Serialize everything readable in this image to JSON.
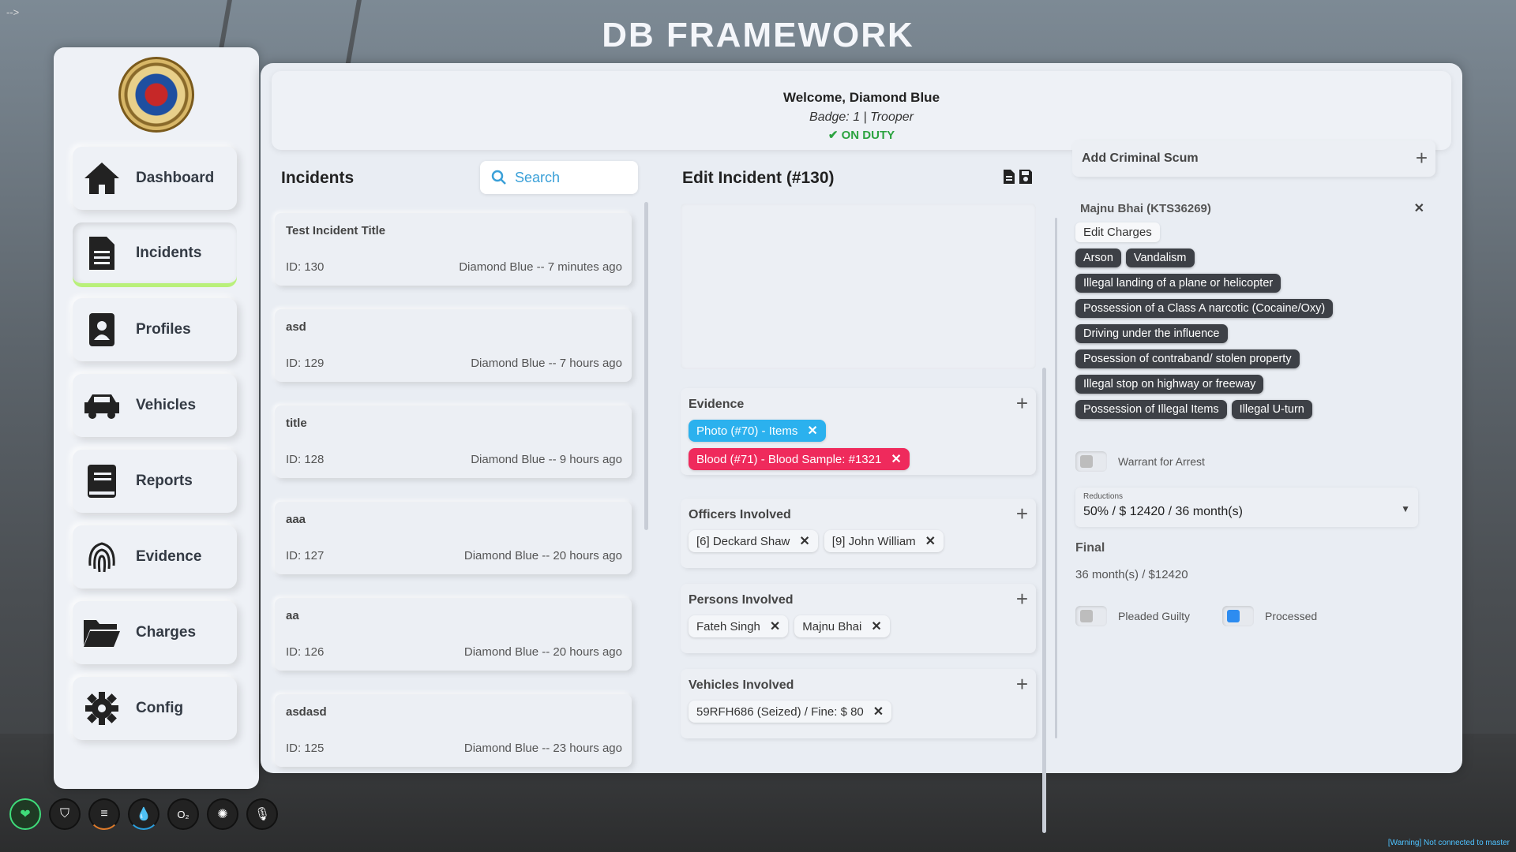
{
  "page": {
    "corner_mark": "-->",
    "app_title": "DB FRAMEWORK"
  },
  "sidebar": {
    "items": [
      {
        "label": "Dashboard",
        "icon": "home-icon"
      },
      {
        "label": "Incidents",
        "icon": "document-icon",
        "active": true
      },
      {
        "label": "Profiles",
        "icon": "id-badge-icon"
      },
      {
        "label": "Vehicles",
        "icon": "car-icon"
      },
      {
        "label": "Reports",
        "icon": "book-icon"
      },
      {
        "label": "Evidence",
        "icon": "fingerprint-icon"
      },
      {
        "label": "Charges",
        "icon": "folder-icon"
      },
      {
        "label": "Config",
        "icon": "gear-icon"
      }
    ]
  },
  "header": {
    "welcome": "Welcome, Diamond Blue",
    "badge": "Badge: 1 | Trooper",
    "status": "ON DUTY",
    "status_color": "#2ca340"
  },
  "incidents": {
    "title": "Incidents",
    "search_placeholder": "Search",
    "list": [
      {
        "title": "Test Incident Title",
        "id": "ID: 130",
        "meta": "Diamond Blue -- 7 minutes ago"
      },
      {
        "title": "asd",
        "id": "ID: 129",
        "meta": "Diamond Blue -- 7 hours ago"
      },
      {
        "title": "title",
        "id": "ID: 128",
        "meta": "Diamond Blue -- 9 hours ago"
      },
      {
        "title": "aaa",
        "id": "ID: 127",
        "meta": "Diamond Blue -- 20 hours ago"
      },
      {
        "title": "aa",
        "id": "ID: 126",
        "meta": "Diamond Blue -- 20 hours ago"
      },
      {
        "title": "asdasd",
        "id": "ID: 125",
        "meta": "Diamond Blue -- 23 hours ago"
      }
    ]
  },
  "edit": {
    "title": "Edit Incident (#130)",
    "evidence": {
      "title": "Evidence",
      "tags": [
        {
          "label": "Photo (#70) - Items",
          "color": "#2bb1ee"
        },
        {
          "label": "Blood (#71) - Blood Sample: #1321",
          "color": "#ef2a5c"
        }
      ]
    },
    "officers": {
      "title": "Officers Involved",
      "tags": [
        "[6] Deckard Shaw",
        "[9] John William"
      ]
    },
    "persons": {
      "title": "Persons Involved",
      "tags": [
        "Fateh Singh",
        "Majnu Bhai"
      ]
    },
    "vehicles": {
      "title": "Vehicles Involved",
      "tags": [
        "59RFH686 (Seized) / Fine: $ 80"
      ]
    }
  },
  "criminal": {
    "add_title": "Add Criminal Scum",
    "name": "Majnu Bhai (KTS36269)",
    "edit_charges": "Edit Charges",
    "charges": [
      "Arson",
      "Vandalism",
      "Illegal landing of a plane or helicopter",
      "Possession of a Class A narcotic (Cocaine/Oxy)",
      "Driving under the influence",
      "Posession of contraband/ stolen property",
      "Illegal stop on highway or freeway",
      "Possession of Illegal Items",
      "Illegal U-turn"
    ],
    "warrant_label": "Warrant for Arrest",
    "reductions_label": "Reductions",
    "reductions_value": "50% / $ 12420 / 36 month(s)",
    "final_label": "Final",
    "final_value": "36 month(s) / $12420",
    "pleaded_label": "Pleaded Guilty",
    "processed_label": "Processed",
    "processed_on": true
  },
  "hud": {
    "o2_label": "O₂"
  },
  "corner_log": [
    "[Warning] Not connected to master"
  ]
}
